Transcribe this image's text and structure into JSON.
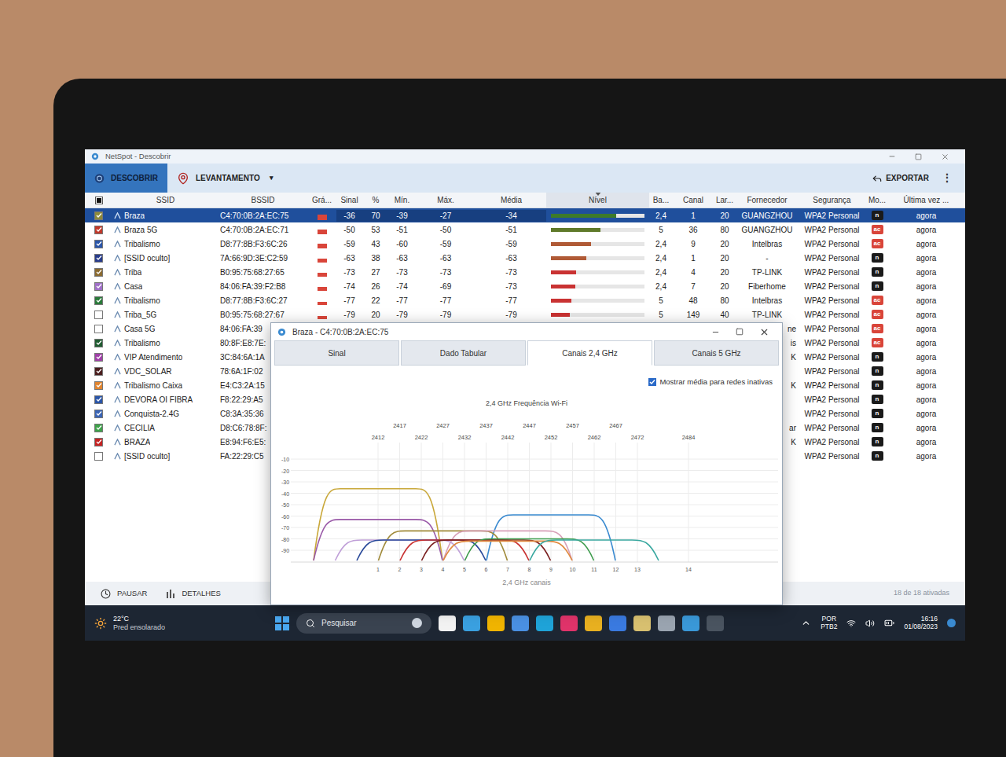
{
  "window": {
    "title": "NetSpot - Descobrir"
  },
  "toolbar": {
    "tabs": [
      {
        "label": "DESCOBRIR",
        "selected": true
      },
      {
        "label": "LEVANTAMENTO",
        "selected": false,
        "caret": "▾"
      }
    ],
    "export": "EXPORTAR",
    "more": "⋮"
  },
  "table": {
    "select_all": {
      "partial": true
    },
    "columns": [
      {
        "label": "SSID",
        "sorted": false
      },
      {
        "label": "BSSID",
        "sorted": false
      },
      {
        "label": "Grá...",
        "sorted": false
      },
      {
        "label": "Sinal",
        "sorted": false
      },
      {
        "label": "%",
        "sorted": false
      },
      {
        "label": "Mín.",
        "sorted": false
      },
      {
        "label": "Máx.",
        "sorted": false
      },
      {
        "label": "Média",
        "sorted": false
      },
      {
        "label": "Nível",
        "sorted": true
      },
      {
        "label": "Ba...",
        "sorted": false
      },
      {
        "label": "Canal",
        "sorted": false
      },
      {
        "label": "Lar...",
        "sorted": false
      },
      {
        "label": "Fornecedor",
        "sorted": false
      },
      {
        "label": "Segurança",
        "sorted": false
      },
      {
        "label": "Mo...",
        "sorted": false
      },
      {
        "label": "Última vez ...",
        "sorted": false
      }
    ],
    "rows": [
      {
        "selected": true,
        "checked": true,
        "color": "#8c8a3a",
        "ssid": "Braza",
        "bssid": "C4:70:0B:2A:EC:75",
        "signal": "-36",
        "percent": "70",
        "min": "-39",
        "max": "-27",
        "avg": "-34",
        "level": 0.7,
        "band": "2,4",
        "channel": "1",
        "width": "20",
        "vendor": "GUANGZHOU",
        "security": "WPA2 Personal",
        "mode": {
          "text": "n",
          "color": "#1a1a1a"
        },
        "last_seen": "agora"
      },
      {
        "selected": false,
        "checked": true,
        "color": "#c0392b",
        "ssid": "Braza 5G",
        "bssid": "C4:70:0B:2A:EC:71",
        "signal": "-50",
        "percent": "53",
        "min": "-51",
        "max": "-50",
        "avg": "-51",
        "level": 0.53,
        "band": "5",
        "channel": "36",
        "width": "80",
        "vendor": "GUANGZHOU",
        "security": "WPA2 Personal",
        "mode": {
          "text": "ac",
          "color": "#d9453a"
        },
        "last_seen": "agora"
      },
      {
        "selected": false,
        "checked": true,
        "color": "#2a55a8",
        "ssid": "Tribalismo",
        "bssid": "D8:77:8B:F3:6C:26",
        "signal": "-59",
        "percent": "43",
        "min": "-60",
        "max": "-59",
        "avg": "-59",
        "level": 0.43,
        "band": "2,4",
        "channel": "9",
        "width": "20",
        "vendor": "Intelbras",
        "security": "WPA2 Personal",
        "mode": {
          "text": "ac",
          "color": "#d9453a"
        },
        "last_seen": "agora"
      },
      {
        "selected": false,
        "checked": true,
        "color": "#283c8c",
        "ssid": "[SSID oculto]",
        "bssid": "7A:66:9D:3E:C2:59",
        "signal": "-63",
        "percent": "38",
        "min": "-63",
        "max": "-63",
        "avg": "-63",
        "level": 0.38,
        "band": "2,4",
        "channel": "1",
        "width": "20",
        "vendor": "-",
        "security": "WPA2 Personal",
        "mode": {
          "text": "n",
          "color": "#1a1a1a"
        },
        "last_seen": "agora"
      },
      {
        "selected": false,
        "checked": true,
        "color": "#8a6a30",
        "ssid": "Triba",
        "bssid": "B0:95:75:68:27:65",
        "signal": "-73",
        "percent": "27",
        "min": "-73",
        "max": "-73",
        "avg": "-73",
        "level": 0.27,
        "band": "2,4",
        "channel": "4",
        "width": "20",
        "vendor": "TP-LINK",
        "security": "WPA2 Personal",
        "mode": {
          "text": "n",
          "color": "#1a1a1a"
        },
        "last_seen": "agora"
      },
      {
        "selected": false,
        "checked": true,
        "color": "#a070c8",
        "ssid": "Casa",
        "bssid": "84:06:FA:39:F2:B8",
        "signal": "-74",
        "percent": "26",
        "min": "-74",
        "max": "-69",
        "avg": "-73",
        "level": 0.26,
        "band": "2,4",
        "channel": "7",
        "width": "20",
        "vendor": "Fiberhome",
        "security": "WPA2 Personal",
        "mode": {
          "text": "n",
          "color": "#1a1a1a"
        },
        "last_seen": "agora"
      },
      {
        "selected": false,
        "checked": true,
        "color": "#2a7a3a",
        "ssid": "Tribalismo",
        "bssid": "D8:77:8B:F3:6C:27",
        "signal": "-77",
        "percent": "22",
        "min": "-77",
        "max": "-77",
        "avg": "-77",
        "level": 0.22,
        "band": "5",
        "channel": "48",
        "width": "80",
        "vendor": "Intelbras",
        "security": "WPA2 Personal",
        "mode": {
          "text": "ac",
          "color": "#d9453a"
        },
        "last_seen": "agora"
      },
      {
        "selected": false,
        "checked": false,
        "color": "#ffffff",
        "ssid": "Triba_5G",
        "bssid": "B0:95:75:68:27:67",
        "signal": "-79",
        "percent": "20",
        "min": "-79",
        "max": "-79",
        "avg": "-79",
        "level": 0.2,
        "band": "5",
        "channel": "149",
        "width": "40",
        "vendor": "TP-LINK",
        "security": "WPA2 Personal",
        "mode": {
          "text": "ac",
          "color": "#d9453a"
        },
        "last_seen": "agora"
      },
      {
        "selected": false,
        "checked": false,
        "color": "#ffffff",
        "ssid": "Casa 5G",
        "bssid": "84:06:FA:39",
        "vendor": "ne",
        "security": "WPA2 Personal",
        "mode": {
          "text": "ac",
          "color": "#d9453a"
        },
        "last_seen": "agora"
      },
      {
        "selected": false,
        "checked": true,
        "color": "#1f5a30",
        "ssid": "Tribalismo",
        "bssid": "80:8F:E8:7E:",
        "vendor": "is",
        "security": "WPA2 Personal",
        "mode": {
          "text": "ac",
          "color": "#d9453a"
        },
        "last_seen": "agora"
      },
      {
        "selected": false,
        "checked": true,
        "color": "#a040a8",
        "ssid": "VIP Atendimento",
        "bssid": "3C:84:6A:1A",
        "vendor": "K",
        "security": "WPA2 Personal",
        "mode": {
          "text": "n",
          "color": "#1a1a1a"
        },
        "last_seen": "agora"
      },
      {
        "selected": false,
        "checked": true,
        "color": "#4a1e1e",
        "ssid": "VDC_SOLAR",
        "bssid": "78:6A:1F:02",
        "vendor": "",
        "security": "WPA2 Personal",
        "mode": {
          "text": "n",
          "color": "#1a1a1a"
        },
        "last_seen": "agora"
      },
      {
        "selected": false,
        "checked": true,
        "color": "#e0842f",
        "ssid": "Tribalismo Caixa",
        "bssid": "E4:C3:2A:15",
        "vendor": "K",
        "security": "WPA2 Personal",
        "mode": {
          "text": "n",
          "color": "#1a1a1a"
        },
        "last_seen": "agora"
      },
      {
        "selected": false,
        "checked": true,
        "color": "#2a55a8",
        "ssid": "DEVORA OI FIBRA",
        "bssid": "F8:22:29:A5",
        "vendor": "",
        "security": "WPA2 Personal",
        "mode": {
          "text": "n",
          "color": "#1a1a1a"
        },
        "last_seen": "agora"
      },
      {
        "selected": false,
        "checked": true,
        "color": "#3a64b4",
        "ssid": "Conquista-2.4G",
        "bssid": "C8:3A:35:36",
        "vendor": "",
        "security": "WPA2 Personal",
        "mode": {
          "text": "n",
          "color": "#1a1a1a"
        },
        "last_seen": "agora"
      },
      {
        "selected": false,
        "checked": true,
        "color": "#3ea24a",
        "ssid": "CECILIA",
        "bssid": "D8:C6:78:8F:",
        "vendor": "ar",
        "security": "WPA2 Personal",
        "mode": {
          "text": "n",
          "color": "#1a1a1a"
        },
        "last_seen": "agora"
      },
      {
        "selected": false,
        "checked": true,
        "color": "#c42222",
        "ssid": "BRAZA",
        "bssid": "E8:94:F6:E5:",
        "vendor": "K",
        "security": "WPA2 Personal",
        "mode": {
          "text": "n",
          "color": "#1a1a1a"
        },
        "last_seen": "agora"
      },
      {
        "selected": false,
        "checked": false,
        "color": "#ffffff",
        "ssid": "[SSID oculto]",
        "bssid": "FA:22:29:C5",
        "vendor": "",
        "security": "WPA2 Personal",
        "mode": {
          "text": "n",
          "color": "#1a1a1a"
        },
        "last_seen": "agora"
      }
    ]
  },
  "bottom_bar": {
    "pause": "PAUSAR",
    "details": "DETALHES",
    "count": "18 de 18 ativadas"
  },
  "dialog": {
    "title": "Braza - C4:70:0B:2A:EC:75",
    "tabs": [
      {
        "label": "Sinal",
        "selected": false
      },
      {
        "label": "Dado Tabular",
        "selected": false
      },
      {
        "label": "Canais 2,4 GHz",
        "selected": true
      },
      {
        "label": "Canais 5 GHz",
        "selected": false
      }
    ],
    "option": {
      "label": "Mostrar média para redes inativas",
      "checked": true
    },
    "chart": {
      "title": "2,4 GHz Frequência Wi-Fi",
      "freq_upper": [
        "2417",
        "2427",
        "2437",
        "2447",
        "2457",
        "2467"
      ],
      "freq_lower": [
        "2412",
        "2422",
        "2432",
        "2442",
        "2452",
        "2462",
        "2472",
        "2484"
      ],
      "y_ticks": [
        "-10",
        "-20",
        "-30",
        "-40",
        "-50",
        "-60",
        "-70",
        "-80",
        "-90"
      ],
      "x_ticks": [
        "1",
        "2",
        "3",
        "4",
        "5",
        "6",
        "7",
        "8",
        "9",
        "10",
        "11",
        "12",
        "13",
        "14"
      ],
      "x_label": "2,4 GHz canais",
      "series": [
        {
          "color": "#c9a83a",
          "channel": 1,
          "signal": -36
        },
        {
          "color": "#9a5aa8",
          "channel": 1,
          "signal": -63
        },
        {
          "color": "#3a8ad0",
          "channel": 9,
          "signal": -59
        },
        {
          "color": "#a08a3a",
          "channel": 4,
          "signal": -73
        },
        {
          "color": "#d8a0b8",
          "channel": 7,
          "signal": -73
        },
        {
          "color": "#c0a0d8",
          "channel": 2,
          "signal": -81
        },
        {
          "color": "#2a4a9a",
          "channel": 3,
          "signal": -81
        },
        {
          "color": "#c83030",
          "channel": 5,
          "signal": -81
        },
        {
          "color": "#7a2020",
          "channel": 6,
          "signal": -81
        },
        {
          "color": "#3a9a4a",
          "channel": 8,
          "signal": -80
        },
        {
          "color": "#e08a40",
          "channel": 7,
          "signal": -82
        },
        {
          "color": "#3aa8a0",
          "channel": 11,
          "signal": -81
        }
      ]
    }
  },
  "taskbar": {
    "temperature": "22°C",
    "weather": "Pred ensolarado",
    "search": "Pesquisar",
    "language": "POR",
    "layout": "PTB2",
    "time": "16:16",
    "date": "01/08/2023"
  }
}
